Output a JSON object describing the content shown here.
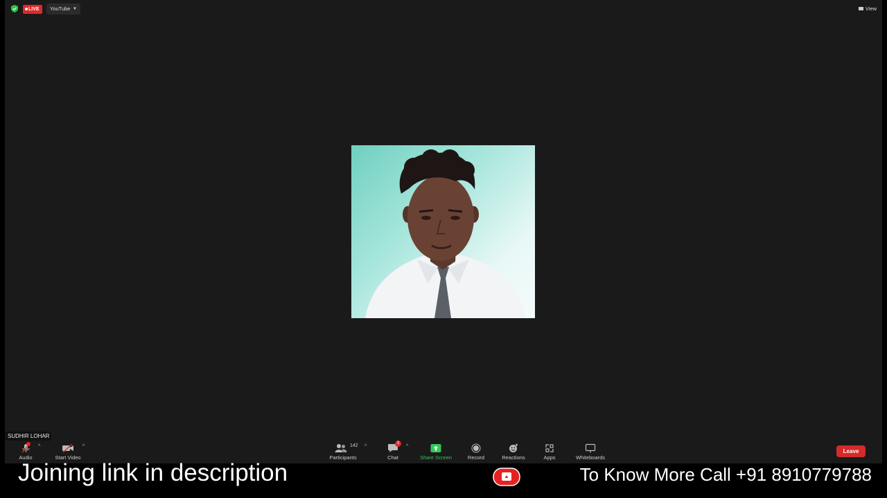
{
  "topbar": {
    "live_label": "LIVE",
    "stream_target": "YouTube",
    "view_label": "View"
  },
  "participant": {
    "name": "SUDHIR LOHAR"
  },
  "toolbar": {
    "audio": "Audio",
    "start_video": "Start Video",
    "participants": "Participants",
    "participants_count": "142",
    "chat": "Chat",
    "chat_badge": "3",
    "share_screen": "Share Screen",
    "record": "Record",
    "reactions": "Reactions",
    "apps": "Apps",
    "whiteboards": "Whiteboards",
    "leave": "Leave"
  },
  "banner": {
    "left_text": "Joining link in description",
    "right_text": "To Know More Call +91 8910779788"
  },
  "colors": {
    "meeting_bg": "#1a1a1a",
    "live_red": "#e02828",
    "share_green": "#35c65a",
    "leave_red": "#d42a2a"
  },
  "icons": [
    "shield-icon",
    "view-icon",
    "microphone-muted-icon",
    "video-off-icon",
    "participants-icon",
    "chat-icon",
    "share-screen-icon",
    "record-icon",
    "reactions-icon",
    "apps-icon",
    "whiteboard-icon",
    "youtube-icon"
  ]
}
